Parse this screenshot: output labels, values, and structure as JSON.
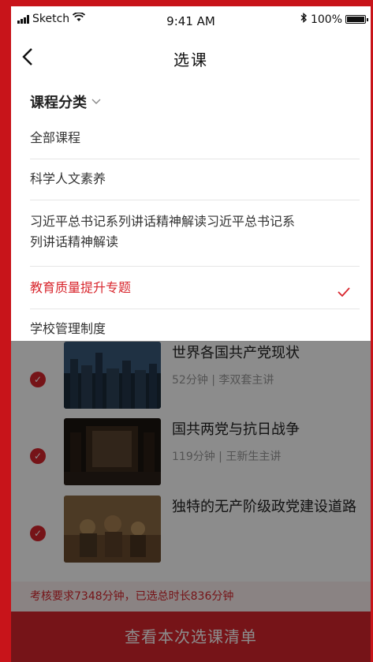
{
  "status": {
    "carrier": "Sketch",
    "time": "9:41 AM",
    "battery": "100%"
  },
  "nav": {
    "back_icon": "chevron-left-icon",
    "title": "选课"
  },
  "dropdown": {
    "header": "课程分类",
    "items": [
      {
        "label": "全部课程",
        "selected": false
      },
      {
        "label": "科学人文素养",
        "selected": false
      },
      {
        "label": "习近平总书记系列讲话精神解读习近平总书记系列讲话精神解读",
        "selected": false
      },
      {
        "label": "教育质量提升专题",
        "selected": true
      },
      {
        "label": "学校管理制度",
        "selected": false
      }
    ]
  },
  "courses": [
    {
      "title": "世界各国共产党现状",
      "meta": "52分钟 | 李双套主讲",
      "checked": true
    },
    {
      "title": "国共两党与抗日战争",
      "meta": "119分钟 | 王新生主讲",
      "checked": true
    },
    {
      "title": "独特的无产阶级政党建设道路",
      "meta": "",
      "checked": true
    }
  ],
  "summary": "考核要求7348分钟，已选总时长836分钟",
  "cta": "查看本次选课清单",
  "colors": {
    "accent": "#d8262d",
    "frame": "#c8141a"
  }
}
